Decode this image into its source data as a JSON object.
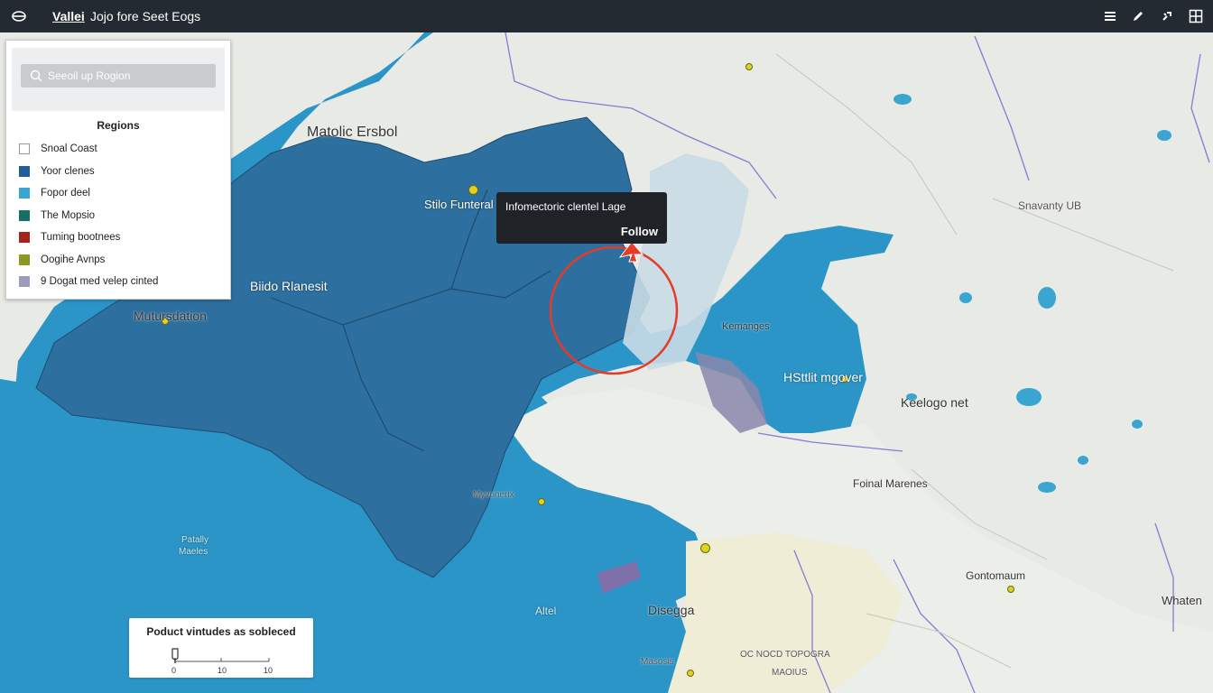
{
  "header": {
    "app_name": "Vallei",
    "title": "Jojo fore Seet Eogs"
  },
  "icons": {
    "logo": "layers-icon",
    "menu": "menu-icon",
    "edit": "pencil-icon",
    "tools": "tool-icon",
    "layout": "grid-icon"
  },
  "search": {
    "placeholder": "Seeoil up Rogion"
  },
  "legend": {
    "title": "Regions",
    "items": [
      {
        "label": "Snoal Coast",
        "color": "#ffffff"
      },
      {
        "label": "Yoor clenes",
        "color": "#1f5e99"
      },
      {
        "label": "Fopor deel",
        "color": "#3aa5d0"
      },
      {
        "label": "The Mopsio",
        "color": "#166e66"
      },
      {
        "label": "Tuming bootnees",
        "color": "#a3261b"
      },
      {
        "label": "Oogihe Avnps",
        "color": "#8d9720"
      },
      {
        "label": "9 Dogat med velep cinted",
        "color": "#9c9bbc"
      }
    ]
  },
  "map_labels": {
    "matolic": "Matolic Ersbol",
    "stile": "Stilo Funteral",
    "biido": "Biido Rlanesit",
    "mutu": "Mutursdation",
    "kemanges": "Kemanges",
    "hshiit": "HSttlit mgover",
    "snavanty": "Snavanty UB",
    "keelong": "Keelogo net",
    "foinal": "Foinal Marenes",
    "myvonerix": "Myvonerix",
    "patally": "Patally",
    "maeles": "Maeles",
    "altel": "Altel",
    "disegga": "Disegga",
    "gontomaum": "Gontomaum",
    "whaten": "Whaten",
    "topogra": "OC NOCD TOPOGRA",
    "maoius": "MAOIUS",
    "masosis": "Masosis"
  },
  "tooltip": {
    "text": "Infomectoric clentel Lage",
    "action": "Follow"
  },
  "scale": {
    "title": "Poduct vintudes as sobleced",
    "ticks": [
      "0",
      "10",
      "10"
    ]
  },
  "colors": {
    "sea": "#2b95c7",
    "region": "#2d6f9e",
    "land": "#e6e8e4",
    "highlight": "#e53b2a"
  }
}
